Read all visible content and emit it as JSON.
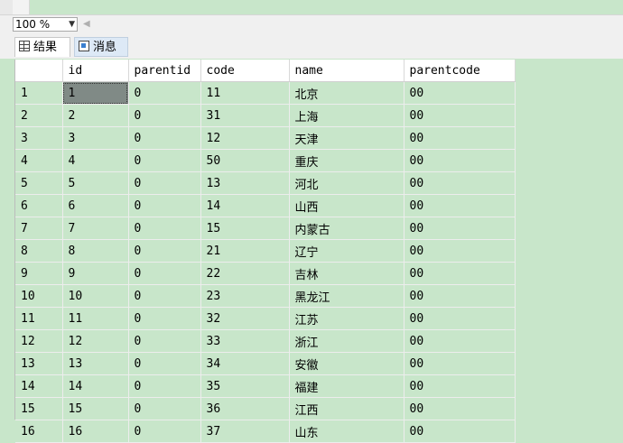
{
  "toolbar": {
    "zoom_value": "100 %"
  },
  "tabs": [
    {
      "label": "结果",
      "icon": "grid-icon"
    },
    {
      "label": "消息",
      "icon": "message-icon"
    }
  ],
  "grid": {
    "columns": [
      "",
      "id",
      "parentid",
      "code",
      "name",
      "parentcode"
    ],
    "selected_cell": {
      "row": 1,
      "column": "id"
    },
    "rows": [
      [
        "1",
        "1",
        "0",
        "11",
        "北京",
        "00"
      ],
      [
        "2",
        "2",
        "0",
        "31",
        "上海",
        "00"
      ],
      [
        "3",
        "3",
        "0",
        "12",
        "天津",
        "00"
      ],
      [
        "4",
        "4",
        "0",
        "50",
        "重庆",
        "00"
      ],
      [
        "5",
        "5",
        "0",
        "13",
        "河北",
        "00"
      ],
      [
        "6",
        "6",
        "0",
        "14",
        "山西",
        "00"
      ],
      [
        "7",
        "7",
        "0",
        "15",
        "内蒙古",
        "00"
      ],
      [
        "8",
        "8",
        "0",
        "21",
        "辽宁",
        "00"
      ],
      [
        "9",
        "9",
        "0",
        "22",
        "吉林",
        "00"
      ],
      [
        "10",
        "10",
        "0",
        "23",
        "黑龙江",
        "00"
      ],
      [
        "11",
        "11",
        "0",
        "32",
        "江苏",
        "00"
      ],
      [
        "12",
        "12",
        "0",
        "33",
        "浙江",
        "00"
      ],
      [
        "13",
        "13",
        "0",
        "34",
        "安徽",
        "00"
      ],
      [
        "14",
        "14",
        "0",
        "35",
        "福建",
        "00"
      ],
      [
        "15",
        "15",
        "0",
        "36",
        "江西",
        "00"
      ],
      [
        "16",
        "16",
        "0",
        "37",
        "山东",
        "00"
      ]
    ]
  },
  "colors": {
    "grid_background": "#c8e6ca",
    "selected_cell": "#808a86",
    "header_background": "#ffffff"
  }
}
